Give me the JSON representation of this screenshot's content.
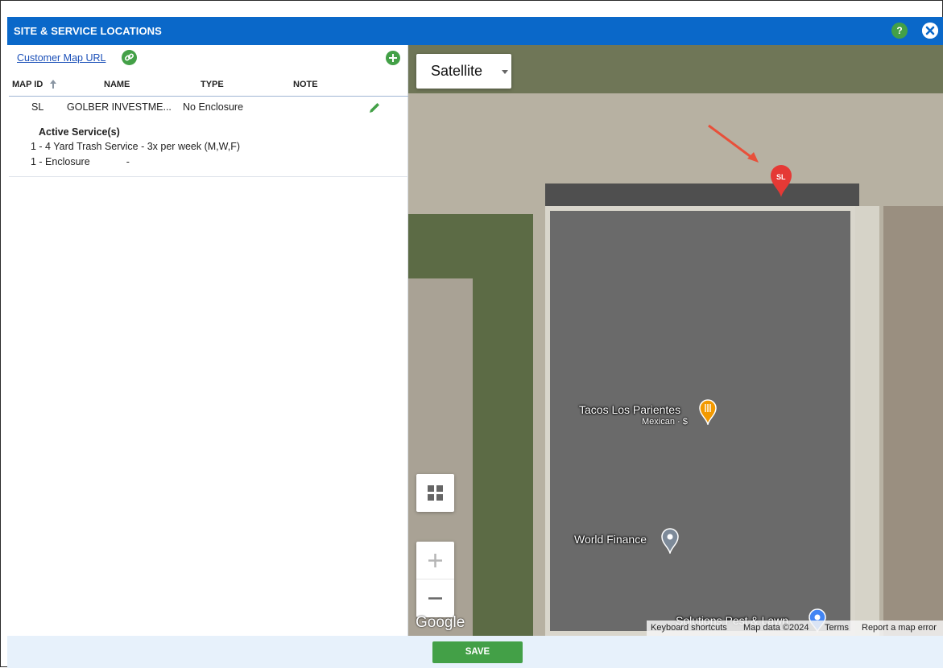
{
  "dialog": {
    "title": "SITE & SERVICE LOCATIONS",
    "help_label": "?"
  },
  "left": {
    "map_url_link": "Customer Map URL",
    "columns": [
      "MAP ID",
      "NAME",
      "TYPE",
      "NOTE"
    ],
    "row": {
      "map_id": "SL",
      "name": "GOLBER INVESTME...",
      "type": "No Enclosure",
      "note": ""
    },
    "services_title": "Active Service(s)",
    "services": [
      "1 - 4 Yard Trash Service - 3x per week (M,W,F)",
      "1 - Enclosure             -"
    ]
  },
  "map": {
    "map_type": "Satellite",
    "marker_label": "SL",
    "pois": [
      {
        "name": "Tacos Los Parientes",
        "sub": "Mexican · $"
      },
      {
        "name": "World Finance",
        "sub": ""
      },
      {
        "name": "Solutions Pest & Lawn",
        "sub": ""
      }
    ],
    "logo": "Google",
    "attribution": [
      "Keyboard shortcuts",
      "Map data ©2024",
      "Terms",
      "Report a map error"
    ]
  },
  "footer": {
    "save_label": "SAVE"
  },
  "colors": {
    "title_bar": "#0a68c9",
    "accent_green": "#43a047",
    "marker_red": "#e53935"
  }
}
